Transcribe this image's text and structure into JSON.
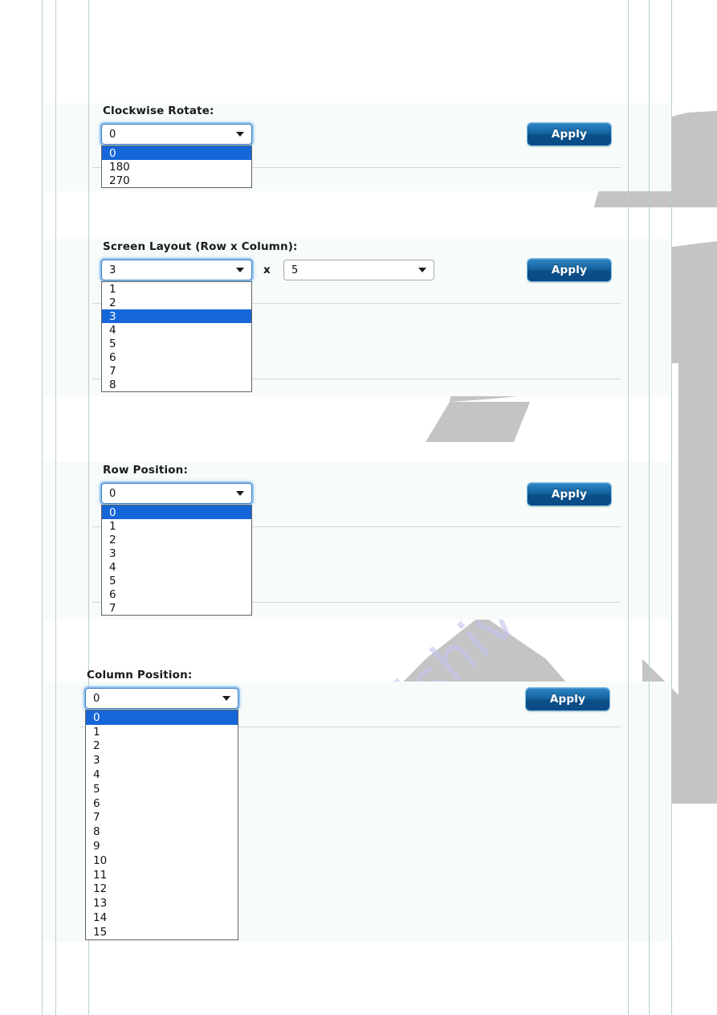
{
  "watermark": {
    "text": "manualshive.com"
  },
  "sections": [
    {
      "key": "clockwise_rotate",
      "label": "Clockwise Rotate:",
      "selects": [
        {
          "name": "rotate-select",
          "value": "0",
          "options": [
            "0",
            "180",
            "270"
          ],
          "selected_index": 0,
          "open": true
        }
      ],
      "apply_label": "Apply"
    },
    {
      "key": "screen_layout",
      "label": "Screen Layout (Row x Column):",
      "separator": "x",
      "selects": [
        {
          "name": "row-count-select",
          "value": "3",
          "options": [
            "1",
            "2",
            "3",
            "4",
            "5",
            "6",
            "7",
            "8"
          ],
          "selected_index": 2,
          "open": true
        },
        {
          "name": "column-count-select",
          "value": "5",
          "options": [
            "5"
          ],
          "selected_index": 0,
          "open": false
        }
      ],
      "apply_label": "Apply"
    },
    {
      "key": "row_position",
      "label": "Row Position:",
      "selects": [
        {
          "name": "row-position-select",
          "value": "0",
          "options": [
            "0",
            "1",
            "2",
            "3",
            "4",
            "5",
            "6",
            "7"
          ],
          "selected_index": 0,
          "open": true
        }
      ],
      "apply_label": "Apply"
    },
    {
      "key": "column_position",
      "label": "Column Position:",
      "selects": [
        {
          "name": "column-position-select",
          "value": "0",
          "options": [
            "0",
            "1",
            "2",
            "3",
            "4",
            "5",
            "6",
            "7",
            "8",
            "9",
            "10",
            "11",
            "12",
            "13",
            "14",
            "15"
          ],
          "selected_index": 0,
          "open": true
        }
      ],
      "apply_label": "Apply"
    }
  ],
  "colors": {
    "panel_background": "#f7fbfa",
    "highlight_blue": "#1566d8",
    "apply_blue": "#14649f",
    "watermark_purple": "#c6c4ef",
    "watermark_gray": "#c4c4c4",
    "frame_line": "#b9cfcf"
  }
}
